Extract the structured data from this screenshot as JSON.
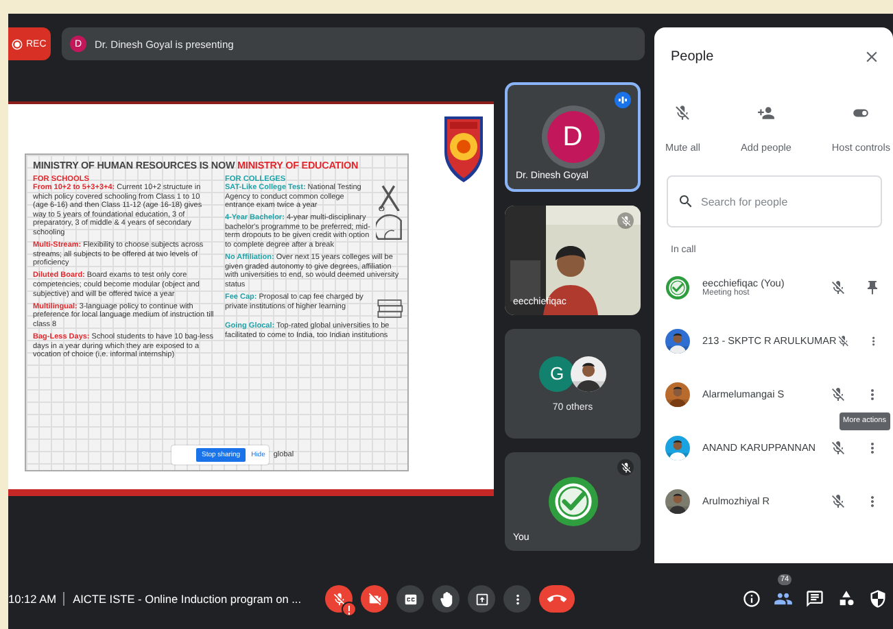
{
  "top_bar": {
    "recording": "REC",
    "presenter_initial": "D",
    "presenting": "Dr. Dinesh Goyal is presenting"
  },
  "presentation": {
    "title": "MINISTRY OF HUMAN RESOURCES IS NOW",
    "title_highlight": "MINISTRY OF EDUCATION",
    "columns": [
      {
        "heading": "FOR SCHOOLS",
        "color": "#e3262b",
        "items": [
          {
            "label": "From 10+2 to 5+3+3+4:",
            "text": "Current 10+2 structure in which policy covered schooling from Class 1 to 10 (age 6-16) and then Class 11-12 (age 16-18) gives way to 5 years of foundational education, 3 of preparatory, 3 of middle & 4 years of secondary schooling"
          },
          {
            "label": "Multi-Stream:",
            "text": "Flexibility to choose subjects across streams; all subjects to be offered at two levels of proficiency"
          },
          {
            "label": "Diluted Board:",
            "text": "Board exams to test only core competencies; could become modular (object and subjective) and will be offered twice a year"
          },
          {
            "label": "Multilingual:",
            "text": "3-language policy to continue with preference for local language medium of instruction till class 8"
          },
          {
            "label": "Bag-Less Days:",
            "text": "School students to have 10 bag-less days in a year during which they are exposed to a vocation of choice (i.e. informal internship)"
          }
        ]
      },
      {
        "heading": "FOR COLLEGES",
        "color": "#1fa3a8",
        "items": [
          {
            "label": "SAT-Like College Test:",
            "text": "National Testing Agency to conduct common college entrance exam twice a year"
          },
          {
            "label": "4-Year Bachelor:",
            "text": "4-year multi-disciplinary bachelor's programme to be preferred; mid-term dropouts to be given credit with option to complete degree after a break"
          },
          {
            "label": "No Affiliation:",
            "text": "Over next 15 years colleges will be given graded autonomy to give degrees, affiliation with universities to end, so would deemed university status"
          },
          {
            "label": "Fee Cap:",
            "text": "Proposal to cap fee charged by private institutions of higher learning"
          },
          {
            "label": "Going Glocal:",
            "text": "Top-rated global universities to be facilitated to come to India, too Indian institutions"
          }
        ]
      }
    ],
    "sharing_bar": {
      "button": "Stop sharing",
      "link": "Hide"
    },
    "covered_tail": "global"
  },
  "tiles": [
    {
      "kind": "avatar",
      "name": "Dr. Dinesh Goyal",
      "initial": "D",
      "selected": true,
      "speaking": true
    },
    {
      "kind": "camera",
      "name": "eecchiefiqac",
      "selected": false,
      "speaking": false,
      "muted": true
    },
    {
      "kind": "group",
      "initial": "G",
      "label": "70 others",
      "selected": false
    },
    {
      "kind": "logo",
      "name": "You",
      "selected": false,
      "speaking": false,
      "muted": true
    }
  ],
  "people_panel": {
    "title": "People",
    "actions": [
      {
        "kind": "mute",
        "label": "Mute all"
      },
      {
        "kind": "add",
        "label": "Add people"
      },
      {
        "kind": "host",
        "label": "Host controls"
      }
    ],
    "search": {
      "placeholder": "Search for people"
    },
    "section": "In call",
    "participants": [
      {
        "kind": "logo",
        "name": "eecchiefiqac (You)",
        "role": "Meeting host",
        "muted": true,
        "pinned": true
      },
      {
        "name": "213 - SKPTC R ARULKUMAR",
        "muted": true,
        "pinned": false
      },
      {
        "name": "Alarmelumangai S",
        "muted": true,
        "pinned": false
      },
      {
        "name": "ANAND KARUPPANNAN",
        "muted": true,
        "pinned": false,
        "tooltip": "More actions"
      },
      {
        "name": "Arulmozhiyal R",
        "muted": true,
        "pinned": false
      }
    ]
  },
  "bottom_bar": {
    "time": "10:12 AM",
    "meeting_title": "AICTE ISTE - Online Induction program on ...",
    "controls": [
      {
        "kind": "mic",
        "on": false,
        "alert": true
      },
      {
        "kind": "camera",
        "on": false
      },
      {
        "kind": "captions",
        "on": false
      },
      {
        "kind": "hand",
        "on": false
      },
      {
        "kind": "present",
        "on": false
      },
      {
        "kind": "more"
      },
      {
        "kind": "end"
      }
    ],
    "side": [
      {
        "kind": "info",
        "selected": false
      },
      {
        "kind": "people",
        "selected": true,
        "badge": "74"
      },
      {
        "kind": "chat",
        "selected": false
      },
      {
        "kind": "activities",
        "selected": false
      },
      {
        "kind": "safety",
        "selected": false
      }
    ]
  }
}
